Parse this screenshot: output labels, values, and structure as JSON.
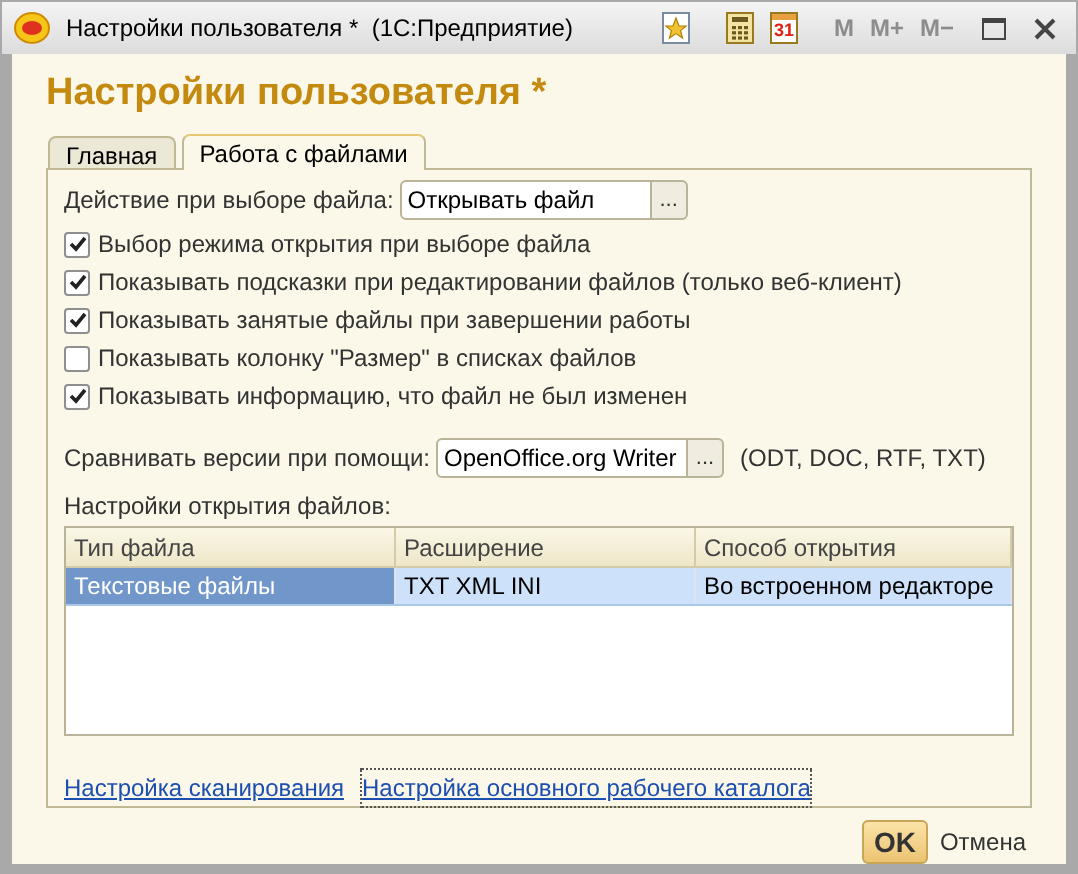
{
  "window": {
    "title": "Настройки пользователя *  (1С:Предприятие)",
    "calendar_day": "31",
    "memory_buttons": [
      {
        "label": "M",
        "disabled": true
      },
      {
        "label": "M+",
        "disabled": true
      },
      {
        "label": "M−",
        "disabled": true
      }
    ]
  },
  "heading": "Настройки пользователя *",
  "tabs": [
    {
      "label": "Главная",
      "selected": false
    },
    {
      "label": "Работа с файлами",
      "selected": true
    }
  ],
  "file_action": {
    "label": "Действие при выборе файла:",
    "value": "Открывать файл",
    "button": "..."
  },
  "options": [
    {
      "label": "Выбор режима открытия при выборе файла",
      "checked": true
    },
    {
      "label": "Показывать подсказки при редактировании файлов (только веб-клиент)",
      "checked": true
    },
    {
      "label": "Показывать занятые файлы при завершении работы",
      "checked": true
    },
    {
      "label": "Показывать колонку \"Размер\" в списках файлов",
      "checked": false
    },
    {
      "label": "Показывать информацию, что файл не был изменен",
      "checked": true
    }
  ],
  "compare": {
    "label": "Сравнивать версии при помощи:",
    "value": "OpenOffice.org Writer",
    "button": "...",
    "note": "(ODT, DOC, RTF, TXT)"
  },
  "table": {
    "caption": "Настройки открытия файлов:",
    "columns": [
      "Тип файла",
      "Расширение",
      "Способ открытия"
    ],
    "rows": [
      {
        "cells": [
          "Текстовые файлы",
          "TXT XML INI",
          "Во встроенном редакторе"
        ],
        "selected": true
      }
    ]
  },
  "links": [
    {
      "label": "Настройка сканирования",
      "focused": false
    },
    {
      "label": "Настройка основного рабочего каталога",
      "focused": true
    }
  ],
  "buttons": {
    "ok": "OK",
    "cancel": "Отмена"
  }
}
